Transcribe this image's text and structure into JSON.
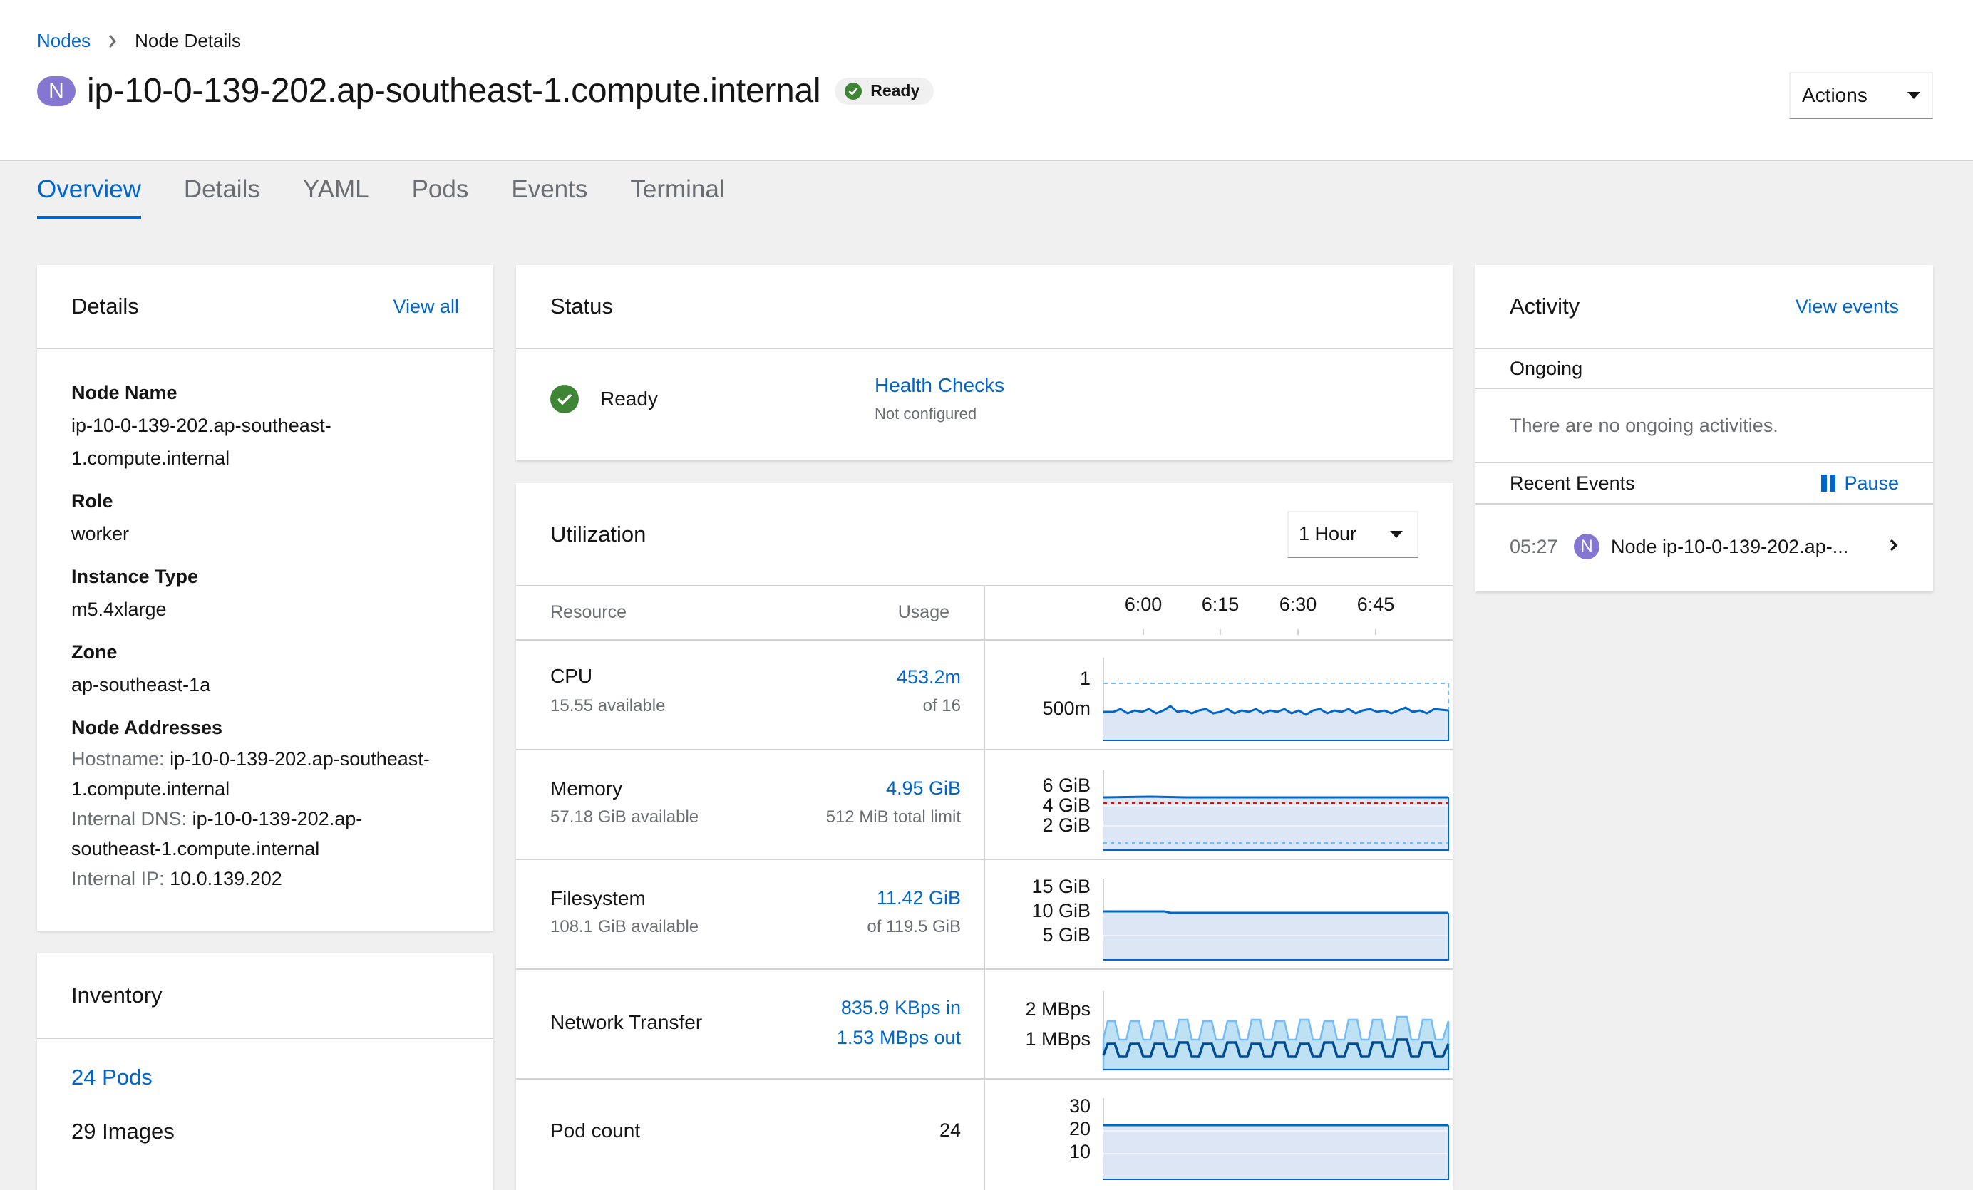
{
  "breadcrumb": {
    "parent": "Nodes",
    "current": "Node Details"
  },
  "title": {
    "badge": "N",
    "name": "ip-10-0-139-202.ap-southeast-1.compute.internal",
    "status": "Ready"
  },
  "actions": {
    "label": "Actions"
  },
  "tabs": [
    "Overview",
    "Details",
    "YAML",
    "Pods",
    "Events",
    "Terminal"
  ],
  "active_tab": "Overview",
  "details": {
    "title": "Details",
    "view_all": "View all",
    "node_name_label": "Node Name",
    "node_name_line1": "ip-10-0-139-202.ap-southeast-",
    "node_name_line2": "1.compute.internal",
    "role_label": "Role",
    "role": "worker",
    "instance_type_label": "Instance Type",
    "instance_type": "m5.4xlarge",
    "zone_label": "Zone",
    "zone": "ap-southeast-1a",
    "addresses_label": "Node Addresses",
    "hostname_label": "Hostname:",
    "hostname_line1": "ip-10-0-139-202.ap-southeast-",
    "hostname_line2": "1.compute.internal",
    "dns_label": "Internal DNS:",
    "dns_line1": "ip-10-0-139-202.ap-",
    "dns_line2": "southeast-1.compute.internal",
    "ip_label": "Internal IP:",
    "ip": "10.0.139.202"
  },
  "inventory": {
    "title": "Inventory",
    "pods": "24 Pods",
    "images": "29 Images"
  },
  "status": {
    "title": "Status",
    "state": "Ready",
    "health_checks": "Health Checks",
    "health_checks_sub": "Not configured"
  },
  "utilization": {
    "title": "Utilization",
    "range": "1 Hour",
    "col_resource": "Resource",
    "col_usage": "Usage",
    "time_ticks": [
      "6:00",
      "6:15",
      "6:30",
      "6:45"
    ],
    "rows": [
      {
        "name": "CPU",
        "sub": "15.55 available",
        "value": "453.2m",
        "of": "of 16",
        "ticks": [
          "1",
          "500m"
        ]
      },
      {
        "name": "Memory",
        "sub": "57.18 GiB available",
        "value": "4.95 GiB",
        "of": "512 MiB total limit",
        "ticks": [
          "6 GiB",
          "4 GiB",
          "2 GiB"
        ]
      },
      {
        "name": "Filesystem",
        "sub": "108.1 GiB available",
        "value": "11.42 GiB",
        "of": "of 119.5 GiB",
        "ticks": [
          "15 GiB",
          "10 GiB",
          "5 GiB"
        ]
      },
      {
        "name": "Network Transfer",
        "value_in": "835.9 KBps in",
        "value_out": "1.53 MBps out",
        "ticks": [
          "2 MBps",
          "1 MBps"
        ]
      },
      {
        "name": "Pod count",
        "value": "24",
        "ticks": [
          "30",
          "20",
          "10"
        ]
      }
    ]
  },
  "activity": {
    "title": "Activity",
    "view_events": "View events",
    "ongoing": "Ongoing",
    "no_ongoing": "There are no ongoing activities.",
    "recent_events": "Recent Events",
    "pause": "Pause",
    "event": {
      "time": "05:27",
      "badge": "N",
      "text": "Node ip-10-0-139-202.ap-..."
    }
  },
  "colors": {
    "link": "#0066cc",
    "success": "#3e8635",
    "node_badge": "#8476d1",
    "chart_line": "#0066cc",
    "chart_fill": "#dce6f5"
  }
}
